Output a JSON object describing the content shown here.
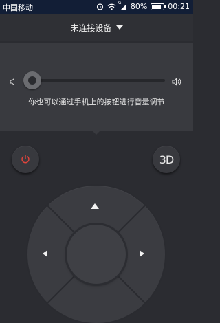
{
  "status_bar": {
    "carrier": "中国移动",
    "signal_badge": "G",
    "battery_percent": "80%",
    "battery_level": 0.8,
    "time": "00:21",
    "icons": [
      "alarm-icon",
      "wifi-icon",
      "signal-icon",
      "battery-icon"
    ]
  },
  "device_selector": {
    "label": "未连接设备"
  },
  "volume": {
    "hint": "你也可以通过手机上的按钮进行音量调节",
    "level": 0.0
  },
  "buttons": {
    "btn3d_label": "3D"
  },
  "colors": {
    "background": "#2b2c31",
    "panel": "#393a3f",
    "power_red": "#e0443c",
    "status_bar": "#121e36"
  }
}
